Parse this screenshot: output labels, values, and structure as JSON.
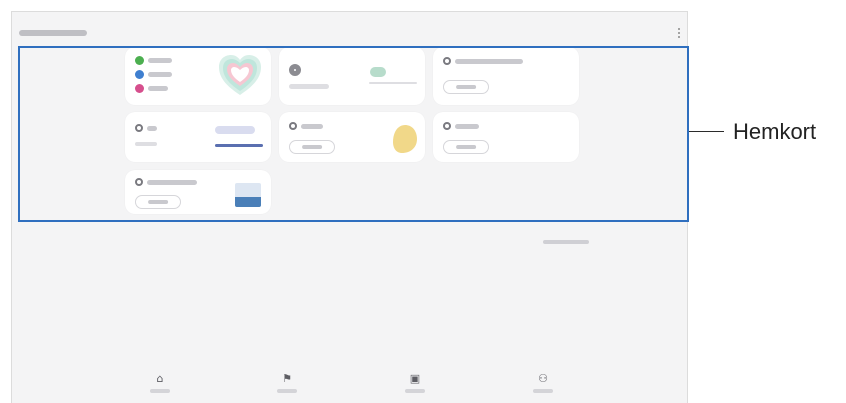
{
  "callout": {
    "label": "Hemkort"
  },
  "colors": {
    "highlight_border": "#2f6fbf",
    "screen_bg": "#f4f4f5",
    "card_bg": "#ffffff",
    "accent_green": "#4caf50",
    "accent_blue": "#3f7fd0",
    "accent_pink": "#d64f8d",
    "heart_pink": "#f6c7d2",
    "heart_teal": "#bfe6dc",
    "bar_purple": "#5a6fb0",
    "lemon_yellow": "#f1d889",
    "water_blue": "#4a7fb8"
  },
  "icons": {
    "menu": "more-vertical-icon",
    "nav": [
      "home-icon",
      "flag-icon",
      "calendar-icon",
      "person-icon"
    ]
  },
  "cards": [
    {
      "name": "activity-summary-card",
      "icons": [
        "steps-icon",
        "activity-icon",
        "fire-icon"
      ],
      "graphic": "heart-rings-icon"
    },
    {
      "name": "sleep-card",
      "icons": [
        "sleep-icon"
      ],
      "graphic": "sleep-badge"
    },
    {
      "name": "workout-card",
      "icons": [
        "workout-icon"
      ]
    },
    {
      "name": "steps-card",
      "icons": [
        "steps-icon"
      ],
      "graphic": "progress-bar"
    },
    {
      "name": "food-card",
      "icons": [
        "food-icon"
      ],
      "graphic": "lemon-icon"
    },
    {
      "name": "body-card",
      "icons": [
        "body-icon"
      ]
    },
    {
      "name": "water-card",
      "icons": [
        "water-icon"
      ],
      "graphic": "water-glass-icon"
    }
  ]
}
